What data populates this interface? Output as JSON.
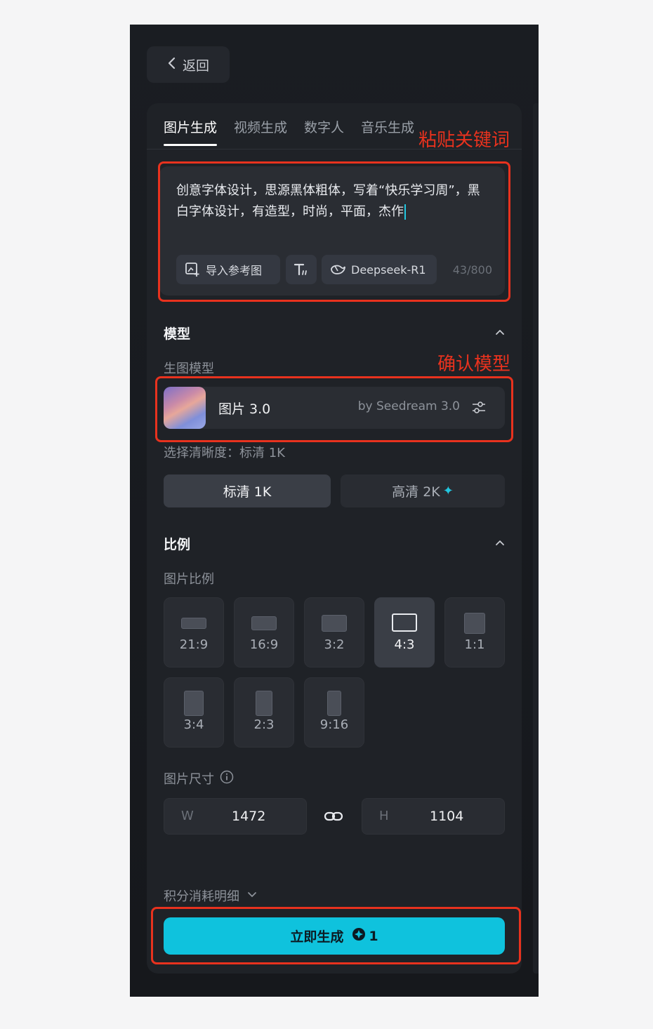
{
  "back": {
    "label": "返回"
  },
  "tabs": [
    {
      "label": "图片生成",
      "active": true
    },
    {
      "label": "视频生成",
      "active": false
    },
    {
      "label": "数字人",
      "active": false
    },
    {
      "label": "音乐生成",
      "active": false
    }
  ],
  "prompt": {
    "text": "创意字体设计，思源黑体粗体，写着“快乐学习周”，黑白字体设计，有造型，时尚，平面，杰作",
    "import_ref_label": "导入参考图",
    "llm_label": "Deepseek-R1",
    "char_count": "43/800"
  },
  "annotations": {
    "paste_keywords": "粘贴关键词",
    "confirm_model": "确认模型"
  },
  "model_section": {
    "title": "模型",
    "sub_label": "生图模型",
    "model_name": "图片 3.0",
    "model_by": "by Seedream 3.0",
    "quality_label": "选择清晰度：标清 1K",
    "quality_options": [
      {
        "label": "标清 1K",
        "selected": true
      },
      {
        "label": "高清 2K",
        "selected": false
      }
    ]
  },
  "ratio_section": {
    "title": "比例",
    "sub_label": "图片比例",
    "ratios": [
      {
        "label": "21:9",
        "selected": false
      },
      {
        "label": "16:9",
        "selected": false
      },
      {
        "label": "3:2",
        "selected": false
      },
      {
        "label": "4:3",
        "selected": true
      },
      {
        "label": "1:1",
        "selected": false
      },
      {
        "label": "3:4",
        "selected": false
      },
      {
        "label": "2:3",
        "selected": false
      },
      {
        "label": "9:16",
        "selected": false
      }
    ],
    "size_label": "图片尺寸",
    "width_label": "W",
    "width_value": "1472",
    "height_label": "H",
    "height_value": "1104"
  },
  "footer": {
    "credits_label": "积分消耗明细",
    "generate_label": "立即生成",
    "cost": "1"
  },
  "colors": {
    "accent": "#0fc2dd",
    "annotation_red": "#e8321e",
    "panel_bg": "#1f2227"
  }
}
